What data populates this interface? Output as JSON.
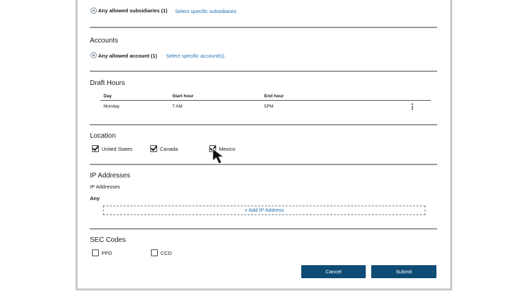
{
  "subsidiaries": {
    "option_label": "Any allowed subsidiaries (1)",
    "link": "Select specific subsidiaries"
  },
  "accounts": {
    "title": "Accounts",
    "option_label": "Any allowed account (1)",
    "link": "Select specific account(s)"
  },
  "draft_hours": {
    "title": "Draft Hours",
    "columns": [
      "Day",
      "Start hour",
      "End hour"
    ],
    "rows": [
      {
        "day": "Monday",
        "start": "7 AM",
        "end": "5PM"
      }
    ]
  },
  "location": {
    "title": "Location",
    "options": [
      {
        "label": "United States",
        "checked": true
      },
      {
        "label": "Canada",
        "checked": true
      },
      {
        "label": "Mexico",
        "checked": true
      }
    ]
  },
  "ip_addresses": {
    "title": "IP Addresses",
    "sub_label": "IP Addresses",
    "value": "Any",
    "add_label": "+ Add IP Address"
  },
  "sec_codes": {
    "title": "SEC Codes",
    "options": [
      {
        "label": "PPD",
        "checked": false
      },
      {
        "label": "CCD",
        "checked": false
      }
    ]
  },
  "actions": {
    "cancel": "Cancel",
    "submit": "Submit"
  },
  "colors": {
    "primary_button": "#0f4c75",
    "link": "#1e6fb3"
  }
}
